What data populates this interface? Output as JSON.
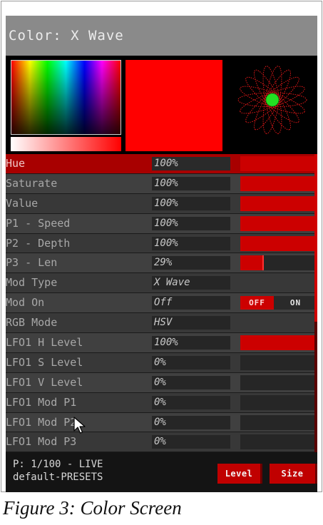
{
  "screen": {
    "title": "Color: X Wave"
  },
  "preview": {
    "swatch_color": "#ff0000"
  },
  "parameters": [
    {
      "name": "Hue",
      "value": "100%",
      "bar_fill": 1.0,
      "control": "bar",
      "selected": true
    },
    {
      "name": "Saturate",
      "value": "100%",
      "bar_fill": 1.0,
      "control": "bar"
    },
    {
      "name": "Value",
      "value": "100%",
      "bar_fill": 1.0,
      "control": "bar"
    },
    {
      "name": "P1 - Speed",
      "value": "100%",
      "bar_fill": 1.0,
      "control": "bar"
    },
    {
      "name": "P2 - Depth",
      "value": "100%",
      "bar_fill": 1.0,
      "control": "bar"
    },
    {
      "name": "P3 - Len",
      "value": "29%",
      "bar_fill": 0.29,
      "control": "bar"
    },
    {
      "name": "Mod Type",
      "value": "X Wave",
      "control": "none"
    },
    {
      "name": "Mod On",
      "value": "Off",
      "control": "toggle",
      "toggle_off": "OFF",
      "toggle_on": "ON"
    },
    {
      "name": "RGB Mode",
      "value": "HSV",
      "control": "none"
    },
    {
      "name": "LFO1 H Level",
      "value": "100%",
      "bar_fill": 1.0,
      "control": "bar"
    },
    {
      "name": "LFO1 S Level",
      "value": "0%",
      "bar_fill": 0,
      "control": "bar"
    },
    {
      "name": "LFO1 V Level",
      "value": "0%",
      "bar_fill": 0,
      "control": "bar"
    },
    {
      "name": "LFO1 Mod P1",
      "value": "0%",
      "bar_fill": 0,
      "control": "bar"
    },
    {
      "name": "LFO1 Mod P2",
      "value": "0%",
      "bar_fill": 0,
      "control": "bar"
    },
    {
      "name": "LFO1 Mod P3",
      "value": "0%",
      "bar_fill": 0,
      "control": "bar"
    }
  ],
  "footer": {
    "preset_line": "P: 1/100 - LIVE",
    "preset_name": "default-PRESETS",
    "level_button": "Level",
    "size_button": "Size"
  },
  "caption": "Figure 3: Color Screen",
  "colors": {
    "accent": "#cc0000",
    "selected_row": "#a80000",
    "title_bar": "#8a8a8a"
  },
  "icons": {
    "pointer": "mouse-cursor-icon"
  }
}
